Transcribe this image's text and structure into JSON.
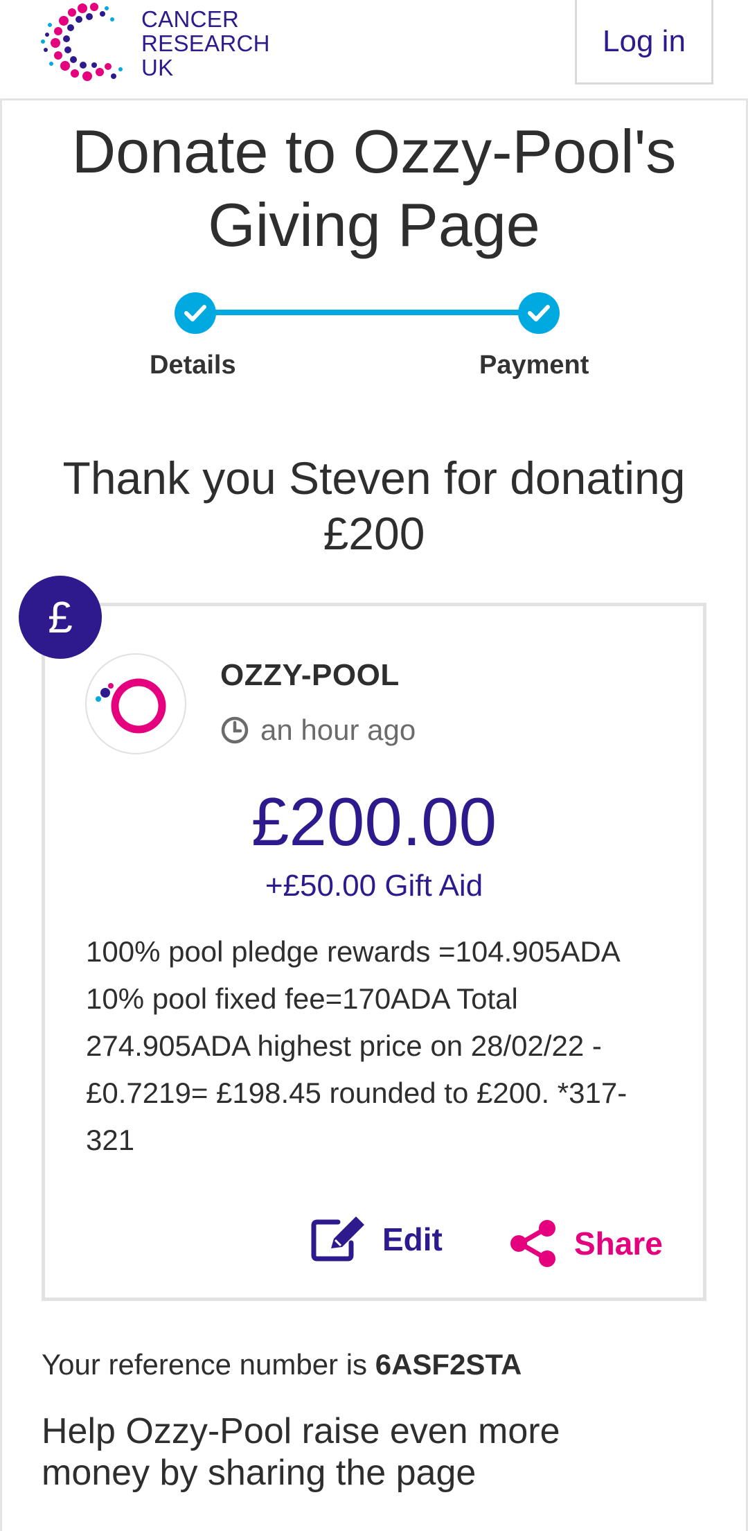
{
  "header": {
    "logo_lines": [
      "CANCER",
      "RESEARCH",
      "UK"
    ],
    "login_label": "Log in"
  },
  "page_title": "Donate to Ozzy-Pool's Giving Page",
  "steps": [
    {
      "label": "Details",
      "status": "complete"
    },
    {
      "label": "Payment",
      "status": "complete"
    }
  ],
  "thank_you": "Thank you Steven for donating £200",
  "donation": {
    "badge_symbol": "£",
    "donor_name": "OZZY-POOL",
    "time": "an hour ago",
    "amount": "£200.00",
    "gift_aid": "+£50.00 Gift Aid",
    "message": "100% pool pledge rewards =104.905ADA 10% pool fixed fee=170ADA Total 274.905ADA highest price on 28/02/22 - £0.7219= £198.45 rounded to £200. *317-321",
    "edit_label": "Edit",
    "share_label": "Share"
  },
  "reference": {
    "prefix": "Your reference number is",
    "number": "6ASF2STA"
  },
  "help_text": "Help Ozzy-Pool raise even more money by sharing the page",
  "colors": {
    "brand_purple": "#2e1a8c",
    "accent_blue": "#00a9e0",
    "share_pink": "#e5007e",
    "text_dark": "#2e2e2e"
  }
}
